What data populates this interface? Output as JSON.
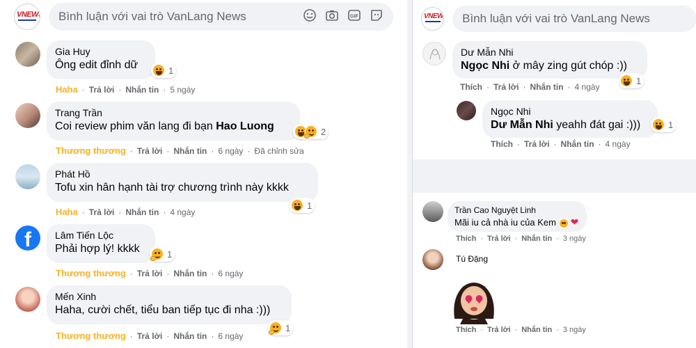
{
  "composer": {
    "placeholder": "Bình luận với vai trò VanLang News",
    "logo_text": "VNEWS"
  },
  "actions_common": {
    "reply": "Trả lời",
    "message": "Nhắn tin",
    "dot": "·"
  },
  "left_comments": [
    {
      "author": "Gia Huy",
      "text": "Ông edit đỉnh dữ",
      "reaction_count": "1",
      "reaction_label": "Haha",
      "time": "5 ngày",
      "edited": ""
    },
    {
      "author": "Trang Trần",
      "text": "Coi review phim văn lang đi bạn",
      "mention": "Hao Luong",
      "reaction_count": "2",
      "reaction_label": "Thương thương",
      "time": "6 ngày",
      "edited": "Đã chỉnh sửa"
    },
    {
      "author": "Phát Hồ",
      "text": "Tofu xin hân hạnh tài trợ chương trình này kkkk",
      "reaction_count": "1",
      "reaction_label": "Haha",
      "time": "4 ngày",
      "edited": ""
    },
    {
      "author": "Lâm Tiến Lộc",
      "text": "Phải hợp lý! kkkk",
      "reaction_count": "1",
      "reaction_label": "Thương thương",
      "time": "6 ngày",
      "edited": ""
    },
    {
      "author": "Mến Xinh",
      "text": "Haha, cười chết, tiểu ban tiếp tục đi nha :)))",
      "reaction_count": "1",
      "reaction_label": "Thương thương",
      "time": "6 ngày",
      "edited": ""
    }
  ],
  "right_comments": [
    {
      "author": "Dư Mẫn Nhi",
      "mention": "Ngọc Nhi",
      "text": " ở mây zing gút chóp :))",
      "reaction_count": "1",
      "reaction_label": "Thích",
      "time": "4 ngày"
    },
    {
      "author": "Ngọc Nhi",
      "mention": "Dư Mẫn Nhi",
      "text": " yeahh đát gai :)))",
      "reaction_count": "1",
      "reaction_label": "Thích",
      "time": "4 ngày"
    },
    {
      "author": "Trần Cao Nguyệt Linh",
      "text": "Mãi iu cả nhà iu của Kem",
      "reaction_label": "Thích",
      "time": "3 ngày"
    },
    {
      "author": "Tú Đặng",
      "reaction_label": "Thích",
      "time": "3 ngày"
    }
  ],
  "colors": {
    "haha": "#f7b125",
    "love": "#f7b125",
    "muted": "#65676b",
    "bubble": "#f0f2f5"
  }
}
